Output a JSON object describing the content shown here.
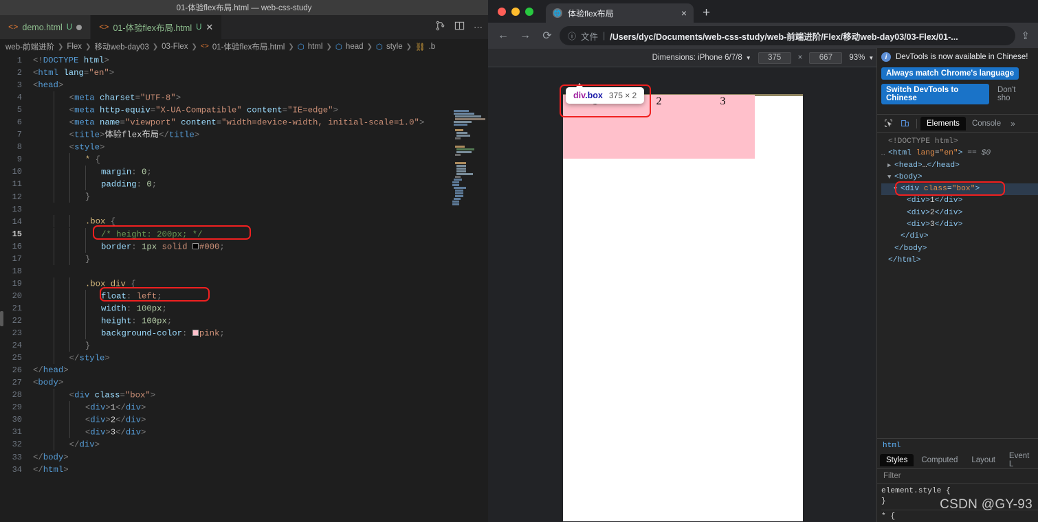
{
  "vscode": {
    "window_title": "01-体验flex布局.html — web-css-study",
    "tabs": [
      {
        "label": "demo.html",
        "state": "U",
        "modified": true,
        "active": false
      },
      {
        "label": "01-体验flex布局.html",
        "state": "U",
        "modified": false,
        "active": true
      }
    ],
    "tab_actions": [
      "split-editor-icon",
      "layout-icon",
      "more-icon"
    ],
    "breadcrumb": [
      "web-前端进阶",
      "Flex",
      "移动web-day03",
      "03-Flex",
      "01-体验flex布局.html",
      "html",
      "head",
      "style",
      ".b"
    ],
    "code_lines": [
      {
        "n": 1,
        "html": "<span class='t-punc'>&lt;!</span><span class='t-tag'>DOCTYPE</span> <span class='t-name'>html</span><span class='t-punc'>&gt;</span>"
      },
      {
        "n": 2,
        "html": "<span class='t-punc'>&lt;</span><span class='t-tag'>html</span> <span class='t-attr'>lang</span><span class='t-punc'>=</span><span class='t-str'>\"en\"</span><span class='t-punc'>&gt;</span>"
      },
      {
        "n": 3,
        "html": "<span class='t-punc'>&lt;</span><span class='t-tag'>head</span><span class='t-punc'>&gt;</span>"
      },
      {
        "n": 4,
        "html": "    <span class='guide'></span>   <span class='t-punc'>&lt;</span><span class='t-tag'>meta</span> <span class='t-attr'>charset</span><span class='t-punc'>=</span><span class='t-str'>\"UTF-8\"</span><span class='t-punc'>&gt;</span>"
      },
      {
        "n": 5,
        "html": "    <span class='guide'></span>   <span class='t-punc'>&lt;</span><span class='t-tag'>meta</span> <span class='t-attr'>http-equiv</span><span class='t-punc'>=</span><span class='t-str'>\"X-UA-Compatible\"</span> <span class='t-attr'>content</span><span class='t-punc'>=</span><span class='t-str'>\"IE=edge\"</span><span class='t-punc'>&gt;</span>"
      },
      {
        "n": 6,
        "html": "    <span class='guide'></span>   <span class='t-punc'>&lt;</span><span class='t-tag'>meta</span> <span class='t-attr'>name</span><span class='t-punc'>=</span><span class='t-str'>\"viewport\"</span> <span class='t-attr'>content</span><span class='t-punc'>=</span><span class='t-str'>\"width=device-width, initial-scale=1.0\"</span><span class='t-punc'>&gt;</span>"
      },
      {
        "n": 7,
        "html": "    <span class='guide'></span>   <span class='t-punc'>&lt;</span><span class='t-tag'>title</span><span class='t-punc'>&gt;</span><span class='t-txt'>体验flex布局</span><span class='t-punc'>&lt;/</span><span class='t-tag'>title</span><span class='t-punc'>&gt;</span>"
      },
      {
        "n": 8,
        "html": "    <span class='guide'></span>   <span class='t-punc'>&lt;</span><span class='t-tag'>style</span><span class='t-punc'>&gt;</span>"
      },
      {
        "n": 9,
        "html": "    <span class='guide'></span>   <span class='guide'></span>   <span class='t-sel'>*</span> <span class='t-punc'>{</span>"
      },
      {
        "n": 10,
        "html": "    <span class='guide'></span>   <span class='guide'></span>   <span class='guide'></span>   <span class='t-prop'>margin</span><span class='t-punc'>:</span> <span class='t-num'>0</span><span class='t-punc'>;</span>"
      },
      {
        "n": 11,
        "html": "    <span class='guide'></span>   <span class='guide'></span>   <span class='guide'></span>   <span class='t-prop'>padding</span><span class='t-punc'>:</span> <span class='t-num'>0</span><span class='t-punc'>;</span>"
      },
      {
        "n": 12,
        "html": "    <span class='guide'></span>   <span class='guide'></span>   <span class='t-punc'>}</span>"
      },
      {
        "n": 13,
        "html": ""
      },
      {
        "n": 14,
        "html": "    <span class='guide'></span>   <span class='guide'></span>   <span class='t-sel'>.box</span> <span class='t-punc'>{</span>"
      },
      {
        "n": 15,
        "html": "    <span class='guide'></span>   <span class='guide'></span>   <span class='guide'></span>   <span class='t-cmt'>/* height: 200px; */</span>"
      },
      {
        "n": 16,
        "html": "    <span class='guide'></span>   <span class='guide'></span>   <span class='guide'></span>   <span class='t-prop'>border</span><span class='t-punc'>:</span> <span class='t-num'>1px</span> <span class='t-val'>solid</span> <span class='swatch' style='background:#000'></span><span class='t-val'>#000</span><span class='t-punc'>;</span>"
      },
      {
        "n": 17,
        "html": "    <span class='guide'></span>   <span class='guide'></span>   <span class='t-punc'>}</span>"
      },
      {
        "n": 18,
        "html": ""
      },
      {
        "n": 19,
        "html": "    <span class='guide'></span>   <span class='guide'></span>   <span class='t-sel'>.box div</span> <span class='t-punc'>{</span>"
      },
      {
        "n": 20,
        "html": "    <span class='guide'></span>   <span class='guide'></span>   <span class='guide'></span>   <span class='t-prop'>float</span><span class='t-punc'>:</span> <span class='t-val'>left</span><span class='t-punc'>;</span>"
      },
      {
        "n": 21,
        "html": "    <span class='guide'></span>   <span class='guide'></span>   <span class='guide'></span>   <span class='t-prop'>width</span><span class='t-punc'>:</span> <span class='t-num'>100px</span><span class='t-punc'>;</span>"
      },
      {
        "n": 22,
        "html": "    <span class='guide'></span>   <span class='guide'></span>   <span class='guide'></span>   <span class='t-prop'>height</span><span class='t-punc'>:</span> <span class='t-num'>100px</span><span class='t-punc'>;</span>"
      },
      {
        "n": 23,
        "html": "    <span class='guide'></span>   <span class='guide'></span>   <span class='guide'></span>   <span class='t-prop'>background-color</span><span class='t-punc'>:</span> <span class='swatch' style='background:#ffc0cb'></span><span class='t-val'>pink</span><span class='t-punc'>;</span>"
      },
      {
        "n": 24,
        "html": "    <span class='guide'></span>   <span class='guide'></span>   <span class='t-punc'>}</span>"
      },
      {
        "n": 25,
        "html": "    <span class='guide'></span>   <span class='t-punc'>&lt;/</span><span class='t-tag'>style</span><span class='t-punc'>&gt;</span>"
      },
      {
        "n": 26,
        "html": "<span class='t-punc'>&lt;/</span><span class='t-tag'>head</span><span class='t-punc'>&gt;</span>"
      },
      {
        "n": 27,
        "html": "<span class='t-punc'>&lt;</span><span class='t-tag'>body</span><span class='t-punc'>&gt;</span>"
      },
      {
        "n": 28,
        "html": "    <span class='guide'></span>   <span class='t-punc'>&lt;</span><span class='t-tag'>div</span> <span class='t-attr'>class</span><span class='t-punc'>=</span><span class='t-str'>\"box\"</span><span class='t-punc'>&gt;</span>"
      },
      {
        "n": 29,
        "html": "    <span class='guide'></span>   <span class='guide'></span>   <span class='t-punc'>&lt;</span><span class='t-tag'>div</span><span class='t-punc'>&gt;</span><span class='t-txt'>1</span><span class='t-punc'>&lt;/</span><span class='t-tag'>div</span><span class='t-punc'>&gt;</span>"
      },
      {
        "n": 30,
        "html": "    <span class='guide'></span>   <span class='guide'></span>   <span class='t-punc'>&lt;</span><span class='t-tag'>div</span><span class='t-punc'>&gt;</span><span class='t-txt'>2</span><span class='t-punc'>&lt;/</span><span class='t-tag'>div</span><span class='t-punc'>&gt;</span>"
      },
      {
        "n": 31,
        "html": "    <span class='guide'></span>   <span class='guide'></span>   <span class='t-punc'>&lt;</span><span class='t-tag'>div</span><span class='t-punc'>&gt;</span><span class='t-txt'>3</span><span class='t-punc'>&lt;/</span><span class='t-tag'>div</span><span class='t-punc'>&gt;</span>"
      },
      {
        "n": 32,
        "html": "    <span class='guide'></span>   <span class='t-punc'>&lt;/</span><span class='t-tag'>div</span><span class='t-punc'>&gt;</span>"
      },
      {
        "n": 33,
        "html": "<span class='t-punc'>&lt;/</span><span class='t-tag'>body</span><span class='t-punc'>&gt;</span>"
      },
      {
        "n": 34,
        "html": "<span class='t-punc'>&lt;/</span><span class='t-tag'>html</span><span class='t-punc'>&gt;</span>"
      }
    ],
    "current_line": 15,
    "annotations": [
      {
        "name": "height-comment-highlight",
        "line": 15
      },
      {
        "name": "float-left-highlight",
        "line": 20
      }
    ]
  },
  "chrome": {
    "tab": {
      "title": "体验flex布局",
      "favicon": "globe-icon",
      "close": "×"
    },
    "new_tab_label": "+",
    "nav": {
      "back": "←",
      "forward": "→",
      "reload": "⟳"
    },
    "omnibox": {
      "info_icon": "info-icon",
      "scheme_label": "文件",
      "url": "/Users/dyc/Documents/web-css-study/web-前端进阶/Flex/移动web-day03/03-Flex/01-..."
    },
    "share_icon": "share-icon",
    "device_bar": {
      "dimensions_label": "Dimensions: iPhone 6/7/8",
      "caret": "▼",
      "width": "375",
      "multiply": "×",
      "height": "667",
      "zoom": "93%",
      "zoom_caret": "▼",
      "more": "kebab-icon"
    },
    "page": {
      "boxes": [
        {
          "label": "1",
          "color": "#ffc0cb"
        },
        {
          "label": "2",
          "color": "#ffc0cb"
        },
        {
          "label": "3",
          "color": "#ffc0cb"
        }
      ],
      "tooltip": {
        "tag": "div",
        "class": ".box",
        "dimensions": "375 × 2"
      }
    }
  },
  "devtools": {
    "banner": {
      "message": "DevTools is now available in Chinese!",
      "primary_button": "Always match Chrome's language",
      "secondary_button": "Switch DevTools to Chinese",
      "tertiary_button": "Don't sho"
    },
    "toolbar": {
      "inspect_icon": "inspect-cursor-icon",
      "device_icon": "device-toggle-icon",
      "tabs": [
        "Elements",
        "Console"
      ],
      "active_tab": "Elements",
      "more_tabs": "»"
    },
    "dom_tree": [
      {
        "indent": 0,
        "twisty": "",
        "html": "<span class='k-doct'>&lt;!DOCTYPE html&gt;</span>"
      },
      {
        "indent": 0,
        "twisty": "…",
        "html": "<span class='k-tag'>&lt;html</span> <span class='k-attr'>lang</span>=<span class='k-val'>\"en\"</span><span class='k-tag'>&gt;</span> <span class='k-dim'>==</span> <span class='k-sel'>$0</span>"
      },
      {
        "indent": 1,
        "twisty": "▶",
        "html": "<span class='k-tag'>&lt;head&gt;</span><span class='k-txt'>…</span><span class='k-tag'>&lt;/head&gt;</span>"
      },
      {
        "indent": 1,
        "twisty": "▼",
        "html": "<span class='k-tag'>&lt;body&gt;</span>"
      },
      {
        "indent": 2,
        "twisty": "▼",
        "selected": true,
        "html": "<span class='k-tag'>&lt;div</span> <span class='k-attr'>class</span>=<span class='k-val'>\"box\"</span><span class='k-tag'>&gt;</span>"
      },
      {
        "indent": 3,
        "twisty": "",
        "html": "<span class='k-tag'>&lt;div&gt;</span><span class='k-txt'>1</span><span class='k-tag'>&lt;/div&gt;</span>"
      },
      {
        "indent": 3,
        "twisty": "",
        "html": "<span class='k-tag'>&lt;div&gt;</span><span class='k-txt'>2</span><span class='k-tag'>&lt;/div&gt;</span>"
      },
      {
        "indent": 3,
        "twisty": "",
        "html": "<span class='k-tag'>&lt;div&gt;</span><span class='k-txt'>3</span><span class='k-tag'>&lt;/div&gt;</span>"
      },
      {
        "indent": 2,
        "twisty": "",
        "html": "<span class='k-tag'>&lt;/div&gt;</span>"
      },
      {
        "indent": 1,
        "twisty": "",
        "html": "<span class='k-tag'>&lt;/body&gt;</span>"
      },
      {
        "indent": 0,
        "twisty": "",
        "html": "<span class='k-tag'>&lt;/html&gt;</span>"
      }
    ],
    "breadcrumb": "html",
    "styles_tabs": [
      "Styles",
      "Computed",
      "Layout",
      "Event L"
    ],
    "styles_active": "Styles",
    "filter_placeholder": "Filter",
    "rules": [
      "element.style {",
      "}",
      "* {"
    ]
  },
  "watermark": "CSDN @GY-93",
  "colors": {
    "pink": "#ffc0cb",
    "highlight_red": "#f02020",
    "devtools_blue": "#1a73c8"
  }
}
